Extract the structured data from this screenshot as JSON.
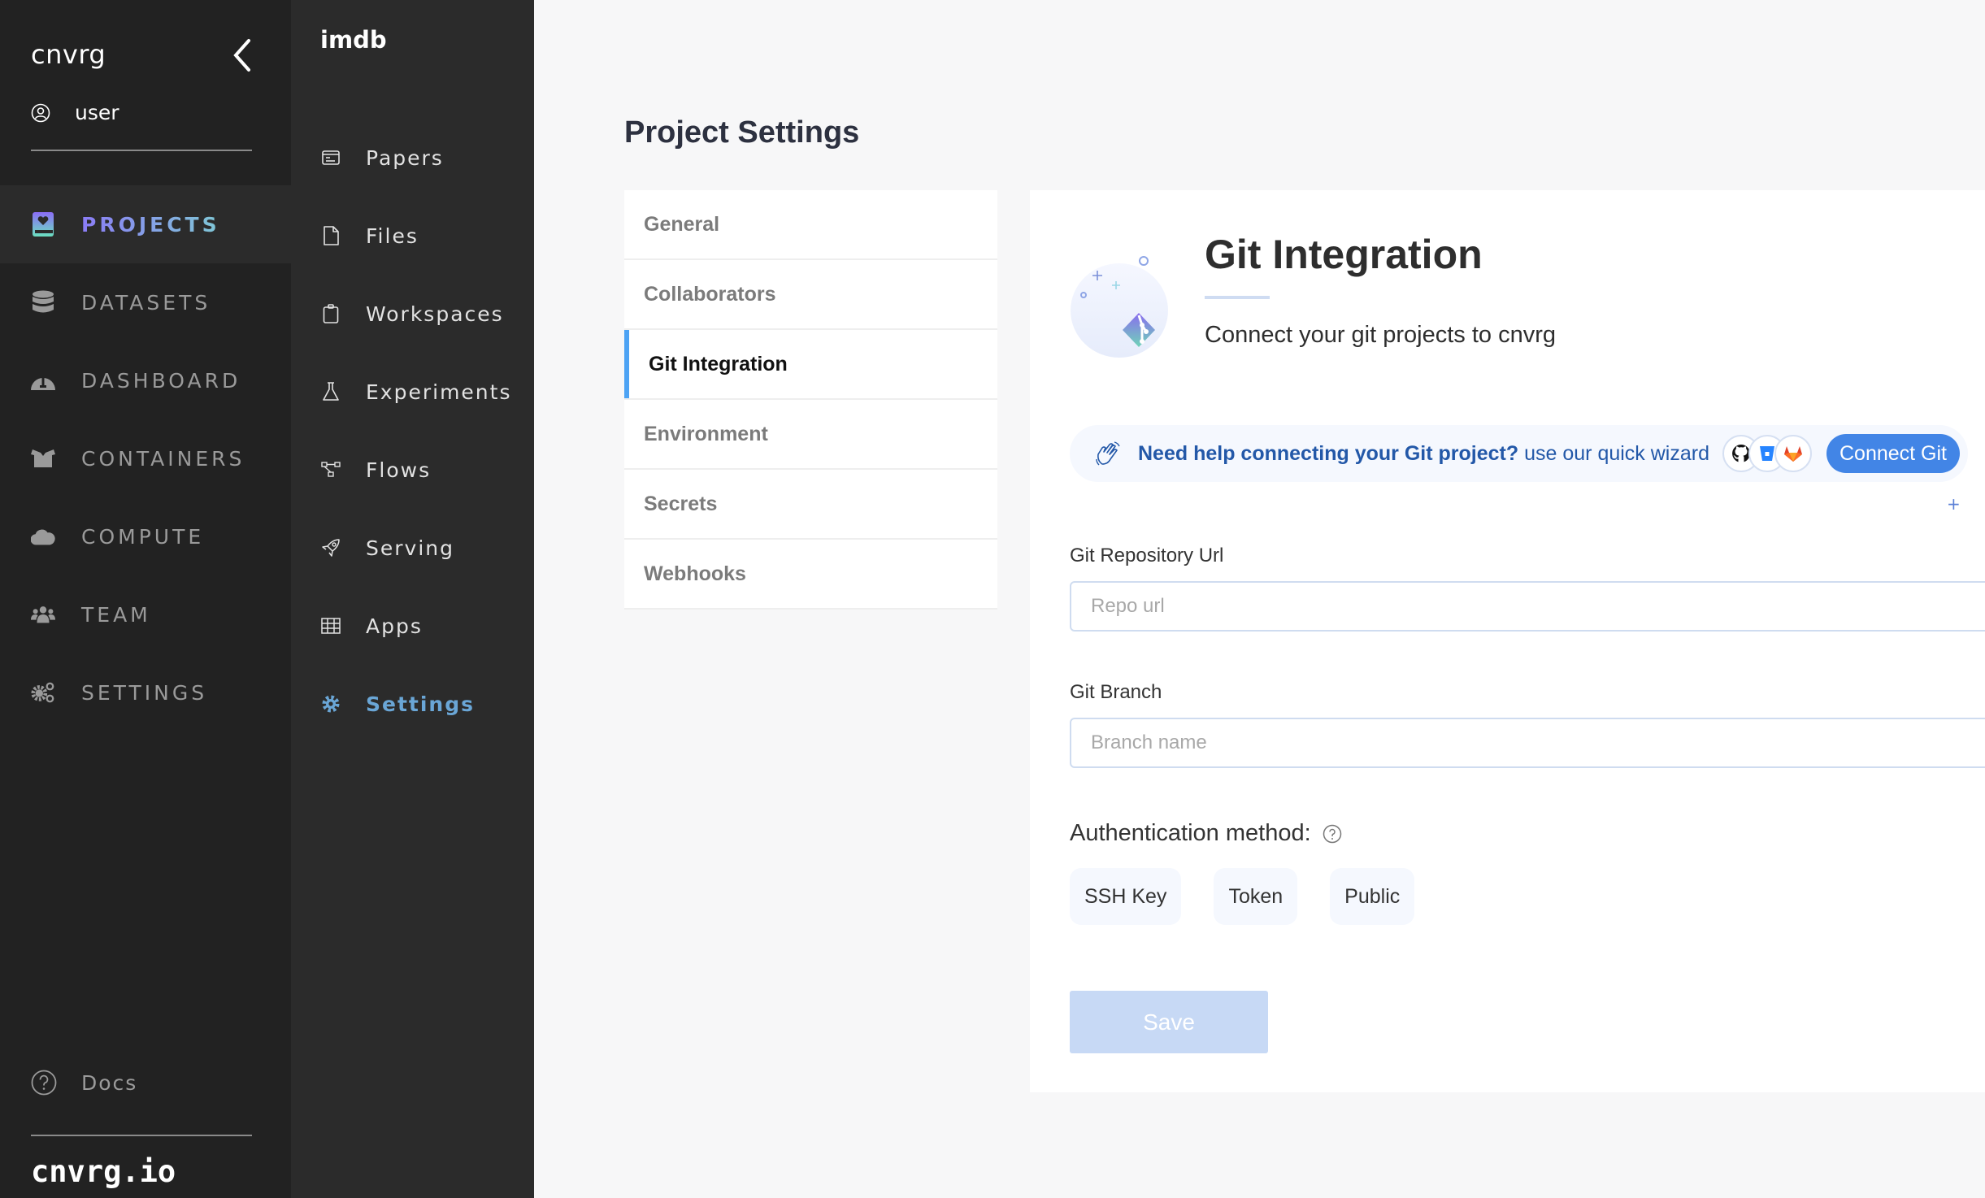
{
  "app": {
    "brand": "cnvrg",
    "footer_brand": "cnvrg.io",
    "user": "user"
  },
  "primary_nav": {
    "items": [
      {
        "label": "PROJECTS",
        "icon": "projects-book-icon",
        "active": true
      },
      {
        "label": "DATASETS",
        "icon": "database-icon",
        "active": false
      },
      {
        "label": "DASHBOARD",
        "icon": "gauge-icon",
        "active": false
      },
      {
        "label": "CONTAINERS",
        "icon": "box-icon",
        "active": false
      },
      {
        "label": "COMPUTE",
        "icon": "cloud-icon",
        "active": false
      },
      {
        "label": "TEAM",
        "icon": "team-icon",
        "active": false
      },
      {
        "label": "SETTINGS",
        "icon": "gears-icon",
        "active": false
      }
    ],
    "docs_label": "Docs"
  },
  "project_nav": {
    "project_name": "imdb",
    "items": [
      {
        "label": "Papers",
        "icon": "papers-icon",
        "active": false
      },
      {
        "label": "Files",
        "icon": "file-icon",
        "active": false
      },
      {
        "label": "Workspaces",
        "icon": "clipboard-icon",
        "active": false
      },
      {
        "label": "Experiments",
        "icon": "flask-icon",
        "active": false
      },
      {
        "label": "Flows",
        "icon": "flow-icon",
        "active": false
      },
      {
        "label": "Serving",
        "icon": "rocket-icon",
        "active": false
      },
      {
        "label": "Apps",
        "icon": "grid-icon",
        "active": false
      },
      {
        "label": "Settings",
        "icon": "gear-icon",
        "active": true
      }
    ]
  },
  "page": {
    "title": "Project Settings",
    "settings_menu": [
      {
        "label": "General",
        "active": false
      },
      {
        "label": "Collaborators",
        "active": false
      },
      {
        "label": "Git Integration",
        "active": true
      },
      {
        "label": "Environment",
        "active": false
      },
      {
        "label": "Secrets",
        "active": false
      },
      {
        "label": "Webhooks",
        "active": false
      }
    ]
  },
  "git": {
    "title": "Git Integration",
    "subtitle": "Connect your git projects to cnvrg",
    "banner": {
      "strong_text": "Need help connecting your Git project?",
      "link_text": "use our quick wizard",
      "providers": [
        "github",
        "bitbucket",
        "gitlab"
      ],
      "button_label": "Connect Git"
    },
    "repo": {
      "label": "Git Repository Url",
      "value": "",
      "placeholder": "Repo url"
    },
    "branch": {
      "label": "Git Branch",
      "value": "",
      "placeholder": "Branch name"
    },
    "auth": {
      "label": "Authentication method:",
      "options": [
        "SSH Key",
        "Token",
        "Public"
      ]
    },
    "save_label": "Save"
  },
  "colors": {
    "accent": "#4da3f4",
    "button_blue": "#4285e6",
    "banner_text": "#2358a8",
    "save_disabled": "#c7d9f5",
    "sidebar_bg": "#222222",
    "subnav_bg": "#2b2b2b",
    "active_subnav": "#6aa6d6"
  }
}
